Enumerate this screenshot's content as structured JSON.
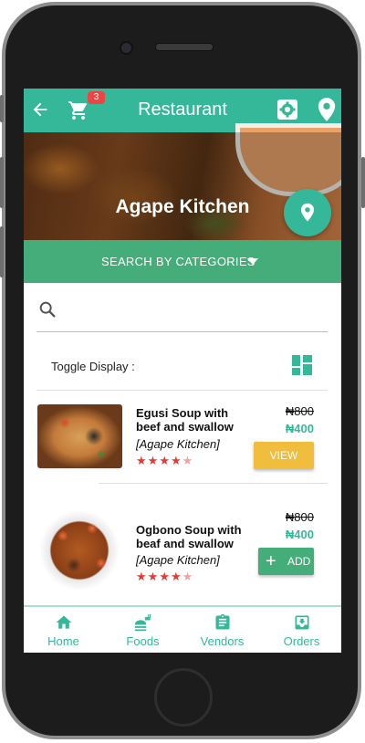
{
  "appbar": {
    "title": "Restaurant",
    "cart_count": "3",
    "icons": [
      "back-arrow-icon",
      "cart-icon",
      "settings-icon",
      "location-pin-icon"
    ]
  },
  "hero": {
    "title": "Agape Kitchen"
  },
  "categories": {
    "label": "SEARCH BY CATEGORIES"
  },
  "search": {
    "placeholder": ""
  },
  "toggle": {
    "label": "Toggle Display :"
  },
  "items": [
    {
      "title": "Egusi Soup with beef and swallow",
      "vendor": "[Agape Kitchen]",
      "old_price": "₦800",
      "new_price": "₦400",
      "rating": 4,
      "max_rating": 5,
      "action_label": "VIEW"
    },
    {
      "title": "Ogbono Soup with beaf and swallow",
      "vendor": "[Agape Kitchen]",
      "old_price": "₦800",
      "new_price": "₦400",
      "rating": 4,
      "max_rating": 5,
      "action_label": "ADD"
    }
  ],
  "bottom_nav": [
    {
      "label": "Home",
      "icon": "home-icon"
    },
    {
      "label": "Foods",
      "icon": "food-icon"
    },
    {
      "label": "Vendors",
      "icon": "clipboard-icon"
    },
    {
      "label": "Orders",
      "icon": "inbox-icon"
    }
  ],
  "colors": {
    "primary": "#35b899",
    "category_bar": "#45ad79",
    "view_button": "#f0be3c",
    "badge": "#ef4444",
    "star": "#e53935"
  }
}
